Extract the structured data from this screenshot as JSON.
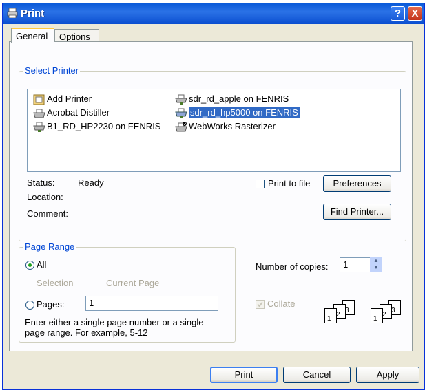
{
  "window": {
    "title": "Print",
    "help_label": "?",
    "close_label": "X"
  },
  "tabs": [
    "General",
    "Options"
  ],
  "select_printer": {
    "label": "Select Printer",
    "printers": [
      {
        "name": "Add Printer",
        "icon": "add-printer-icon",
        "selected": false
      },
      {
        "name": "Acrobat Distiller",
        "icon": "printer-icon",
        "selected": false
      },
      {
        "name": "B1_RD_HP2230 on FENRIS",
        "icon": "network-printer-icon",
        "selected": false
      },
      {
        "name": "sdr_rd_apple on FENRIS",
        "icon": "network-printer-icon",
        "selected": false
      },
      {
        "name": "sdr_rd_hp5000 on FENRIS",
        "icon": "network-printer-icon",
        "selected": true
      },
      {
        "name": "WebWorks Rasterizer",
        "icon": "default-printer-icon",
        "selected": false
      }
    ],
    "status_label": "Status:",
    "status_value": "Ready",
    "location_label": "Location:",
    "location_value": "",
    "comment_label": "Comment:",
    "comment_value": "",
    "print_to_file_label": "Print to file",
    "print_to_file_checked": false,
    "preferences_label": "Preferences",
    "find_printer_label": "Find Printer..."
  },
  "page_range": {
    "label": "Page Range",
    "all_label": "All",
    "selection_label": "Selection",
    "current_page_label": "Current Page",
    "pages_label": "Pages:",
    "pages_value": "1",
    "selected_option": "All",
    "help_text_line1": "Enter either a single page number or a single",
    "help_text_line2": "page range.  For example, 5-12"
  },
  "copies": {
    "label": "Number of copies:",
    "value": "1",
    "collate_label": "Collate",
    "collate_checked": true,
    "collate_pages": [
      "1",
      "2",
      "3"
    ]
  },
  "footer": {
    "print_label": "Print",
    "cancel_label": "Cancel",
    "apply_label": "Apply"
  }
}
